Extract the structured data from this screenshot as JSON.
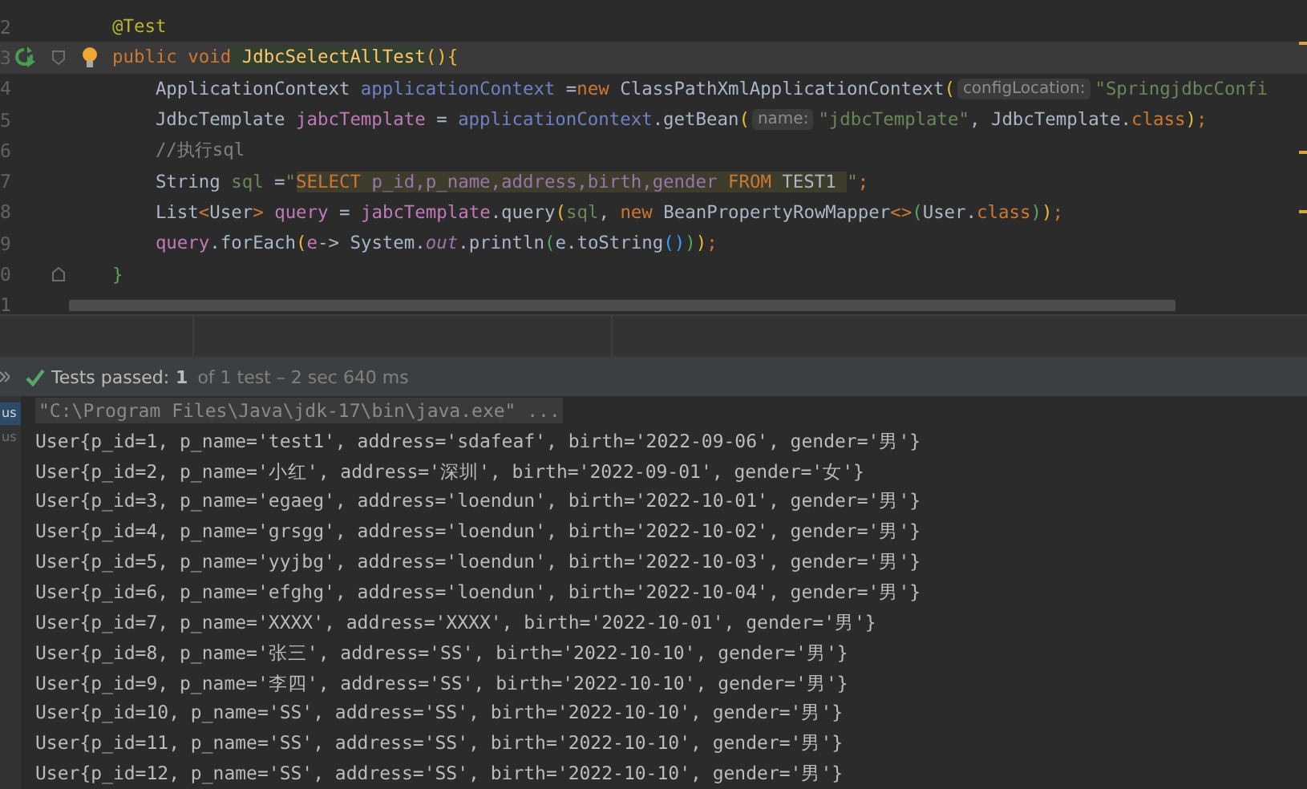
{
  "editor": {
    "lines": [
      {
        "number": "2",
        "current": false,
        "run": false,
        "bulb": false,
        "fold_start": false,
        "fold_end": false,
        "tokens": [
          {
            "text": "@Test",
            "kind": "ann"
          }
        ]
      },
      {
        "number": "3",
        "current": true,
        "run": true,
        "bulb": true,
        "fold_start": true,
        "fold_end": false,
        "tokens": [
          {
            "text": "public",
            "kind": "kw"
          },
          {
            "text": " void",
            "kind": "kw"
          },
          {
            "text": " JdbcSelectAllTest",
            "kind": "method"
          },
          {
            "text": "(){",
            "kind": "bracket"
          }
        ]
      },
      {
        "number": "4",
        "current": false,
        "run": false,
        "bulb": false,
        "fold_start": false,
        "fold_end": false,
        "tokens": [
          {
            "text": "    ApplicationContext ",
            "kind": "plain"
          },
          {
            "text": "applicationContext",
            "kind": "local"
          },
          {
            "text": " =",
            "kind": "plain"
          },
          {
            "text": "new",
            "kind": "kw"
          },
          {
            "text": " ClassPathXmlApplicationContext",
            "kind": "plain"
          },
          {
            "text": "(",
            "kind": "bracket"
          },
          {
            "text": "configLocation:",
            "kind": "hint"
          },
          {
            "text": "\"SpringjdbcConfi",
            "kind": "str"
          }
        ]
      },
      {
        "number": "5",
        "current": false,
        "run": false,
        "bulb": false,
        "fold_start": false,
        "fold_end": false,
        "tokens": [
          {
            "text": "    JdbcTemplate ",
            "kind": "plain"
          },
          {
            "text": "jabcTemplate",
            "kind": "var2"
          },
          {
            "text": " = ",
            "kind": "plain"
          },
          {
            "text": "applicationContext",
            "kind": "local"
          },
          {
            "text": ".getBean",
            "kind": "plain"
          },
          {
            "text": "(",
            "kind": "bracket"
          },
          {
            "text": "name:",
            "kind": "hint"
          },
          {
            "text": "\"jdbcTemplate\"",
            "kind": "str"
          },
          {
            "text": ", JdbcTemplate.",
            "kind": "plain"
          },
          {
            "text": "class",
            "kind": "kw"
          },
          {
            "text": ")",
            "kind": "bracket"
          },
          {
            "text": ";",
            "kind": "kw"
          }
        ]
      },
      {
        "number": "6",
        "current": false,
        "run": false,
        "bulb": false,
        "fold_start": false,
        "fold_end": false,
        "tokens": [
          {
            "text": "    //执行sql",
            "kind": "comment"
          }
        ]
      },
      {
        "number": "7",
        "current": false,
        "run": false,
        "bulb": false,
        "fold_start": false,
        "fold_end": false,
        "tokens": [
          {
            "text": "    String ",
            "kind": "plain"
          },
          {
            "text": "sql",
            "kind": "var"
          },
          {
            "text": " =",
            "kind": "plain"
          },
          {
            "text": "\"",
            "kind": "str"
          },
          {
            "text": "SELECT",
            "kind": "sqlkw"
          },
          {
            "text": " p_id,p_name,address,birth,gender ",
            "kind": "sqlcol"
          },
          {
            "text": "FROM",
            "kind": "sqlkw"
          },
          {
            "text": " TEST1 ",
            "kind": "sqlplain"
          },
          {
            "text": "\"",
            "kind": "str"
          },
          {
            "text": ";",
            "kind": "kw"
          }
        ]
      },
      {
        "number": "8",
        "current": false,
        "run": false,
        "bulb": false,
        "fold_start": false,
        "fold_end": false,
        "tokens": [
          {
            "text": "    List",
            "kind": "plain"
          },
          {
            "text": "<",
            "kind": "kw"
          },
          {
            "text": "User",
            "kind": "plain"
          },
          {
            "text": ">",
            "kind": "kw"
          },
          {
            "text": " query",
            "kind": "var2"
          },
          {
            "text": " = ",
            "kind": "plain"
          },
          {
            "text": "jabcTemplate",
            "kind": "var2"
          },
          {
            "text": ".query",
            "kind": "plain"
          },
          {
            "text": "(",
            "kind": "bracket"
          },
          {
            "text": "sql",
            "kind": "var"
          },
          {
            "text": ", ",
            "kind": "plain"
          },
          {
            "text": "new",
            "kind": "kw"
          },
          {
            "text": " BeanPropertyRowMapper",
            "kind": "plain"
          },
          {
            "text": "<>",
            "kind": "kw"
          },
          {
            "text": "(",
            "kind": "bracket2"
          },
          {
            "text": "User.",
            "kind": "plain"
          },
          {
            "text": "class",
            "kind": "kw"
          },
          {
            "text": ")",
            "kind": "bracket2"
          },
          {
            "text": ")",
            "kind": "bracket"
          },
          {
            "text": ";",
            "kind": "kw"
          }
        ]
      },
      {
        "number": "9",
        "current": false,
        "run": false,
        "bulb": false,
        "fold_start": false,
        "fold_end": false,
        "tokens": [
          {
            "text": "    query",
            "kind": "var2"
          },
          {
            "text": ".forEach",
            "kind": "plain"
          },
          {
            "text": "(",
            "kind": "bracket"
          },
          {
            "text": "e",
            "kind": "var2"
          },
          {
            "text": "-> System.",
            "kind": "plain"
          },
          {
            "text": "out",
            "kind": "field"
          },
          {
            "text": ".println",
            "kind": "plain"
          },
          {
            "text": "(",
            "kind": "bracket2"
          },
          {
            "text": "e.toString",
            "kind": "plain"
          },
          {
            "text": "()",
            "kind": "bracket3"
          },
          {
            "text": ")",
            "kind": "bracket2"
          },
          {
            "text": ")",
            "kind": "bracket"
          },
          {
            "text": ";",
            "kind": "kw"
          }
        ]
      },
      {
        "number": "0",
        "current": false,
        "run": false,
        "bulb": false,
        "fold_start": false,
        "fold_end": true,
        "tokens": [
          {
            "text": "}",
            "kind": "bracket2"
          }
        ]
      },
      {
        "number": "1",
        "current": false,
        "run": false,
        "bulb": false,
        "fold_start": false,
        "fold_end": false
      }
    ]
  },
  "test_status": {
    "passed": true,
    "label": "Tests passed:",
    "count": "1",
    "detail": "of 1 test – 2 sec 640 ms"
  },
  "side_tabs": [
    {
      "label": "us",
      "selected": true
    },
    {
      "label": "us",
      "selected": false
    }
  ],
  "console": {
    "lines": [
      {
        "kind": "command",
        "text": "\"C:\\Program Files\\Java\\jdk-17\\bin\\java.exe\" ..."
      },
      {
        "kind": "output",
        "text": "User{p_id=1, p_name='test1', address='sdafeaf', birth='2022-09-06', gender='男'}"
      },
      {
        "kind": "output",
        "text": "User{p_id=2, p_name='小红', address='深圳', birth='2022-09-01', gender='女'}"
      },
      {
        "kind": "output",
        "text": "User{p_id=3, p_name='egaeg', address='loendun', birth='2022-10-01', gender='男'}"
      },
      {
        "kind": "output",
        "text": "User{p_id=4, p_name='grsgg', address='loendun', birth='2022-10-02', gender='男'}"
      },
      {
        "kind": "output",
        "text": "User{p_id=5, p_name='yyjbg', address='loendun', birth='2022-10-03', gender='男'}"
      },
      {
        "kind": "output",
        "text": "User{p_id=6, p_name='efghg', address='loendun', birth='2022-10-04', gender='男'}"
      },
      {
        "kind": "output",
        "text": "User{p_id=7, p_name='XXXX', address='XXXX', birth='2022-10-01', gender='男'}"
      },
      {
        "kind": "output",
        "text": "User{p_id=8, p_name='张三', address='SS', birth='2022-10-10', gender='男'}"
      },
      {
        "kind": "output",
        "text": "User{p_id=9, p_name='李四', address='SS', birth='2022-10-10', gender='男'}"
      },
      {
        "kind": "output",
        "text": "User{p_id=10, p_name='SS', address='SS', birth='2022-10-10', gender='男'}"
      },
      {
        "kind": "output",
        "text": "User{p_id=11, p_name='SS', address='SS', birth='2022-10-10', gender='男'}"
      },
      {
        "kind": "output",
        "text": "User{p_id=12, p_name='SS', address='SS', birth='2022-10-10', gender='男'}"
      }
    ]
  }
}
